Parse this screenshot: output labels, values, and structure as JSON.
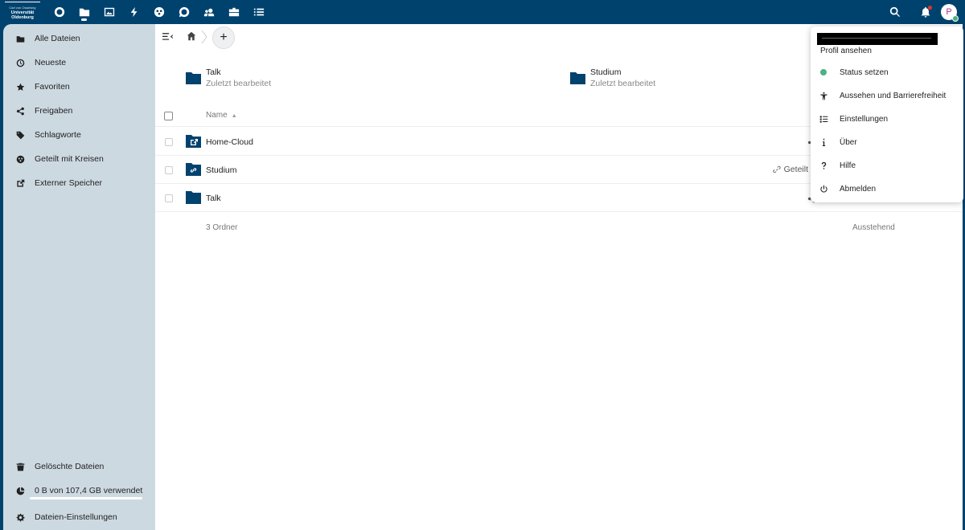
{
  "header": {
    "logo": {
      "line1": "Carl von Ossietzky",
      "line2": "Universität",
      "line3": "Oldenburg"
    },
    "apps": [
      {
        "name": "dashboard",
        "icon": "circle-icon"
      },
      {
        "name": "files",
        "icon": "folder-icon",
        "active": true
      },
      {
        "name": "photos",
        "icon": "image-icon"
      },
      {
        "name": "activity",
        "icon": "lightning-icon"
      },
      {
        "name": "circles",
        "icon": "circles-icon"
      },
      {
        "name": "talk",
        "icon": "chat-icon"
      },
      {
        "name": "contacts",
        "icon": "contacts-icon"
      },
      {
        "name": "deck",
        "icon": "briefcase-icon"
      },
      {
        "name": "tasks",
        "icon": "list-icon"
      }
    ],
    "avatar_initial": "P"
  },
  "sidebar": {
    "items": [
      {
        "label": "Alle Dateien",
        "icon": "folder-icon"
      },
      {
        "label": "Neueste",
        "icon": "clock-icon"
      },
      {
        "label": "Favoriten",
        "icon": "star-icon"
      },
      {
        "label": "Freigaben",
        "icon": "share-icon"
      },
      {
        "label": "Schlagworte",
        "icon": "tag-icon"
      },
      {
        "label": "Geteilt mit Kreisen",
        "icon": "circles-icon"
      },
      {
        "label": "Externer Speicher",
        "icon": "external-icon"
      }
    ],
    "bottom": {
      "deleted": "Gelöschte Dateien",
      "quota": "0 B von 107,4 GB verwendet",
      "quota_fraction": 0.0,
      "settings": "Dateien-Einstellungen"
    }
  },
  "recent": [
    {
      "name": "Talk",
      "sub": "Zuletzt bearbeitet"
    },
    {
      "name": "Studium",
      "sub": "Zuletzt bearbeitet"
    }
  ],
  "table": {
    "col_name": "Name",
    "rows": [
      {
        "name": "Home-Cloud",
        "type": "external-folder"
      },
      {
        "name": "Studium",
        "type": "link-folder",
        "share_label": "Geteilt"
      },
      {
        "name": "Talk",
        "type": "folder"
      }
    ],
    "summary": "3 Ordner",
    "summary_right": "Ausstehend"
  },
  "menu": {
    "profile": "Profil ansehen",
    "items": [
      {
        "label": "Status setzen",
        "icon": "status-dot-icon"
      },
      {
        "label": "Aussehen und Barrierefreiheit",
        "icon": "accessibility-icon"
      },
      {
        "label": "Einstellungen",
        "icon": "settings-list-icon"
      },
      {
        "label": "Über",
        "icon": "info-icon"
      },
      {
        "label": "Hilfe",
        "icon": "help-icon"
      },
      {
        "label": "Abmelden",
        "icon": "power-icon"
      }
    ]
  },
  "colors": {
    "brand": "#00426e",
    "status_online": "#49b382",
    "sidebar": "#cdd9e1"
  }
}
